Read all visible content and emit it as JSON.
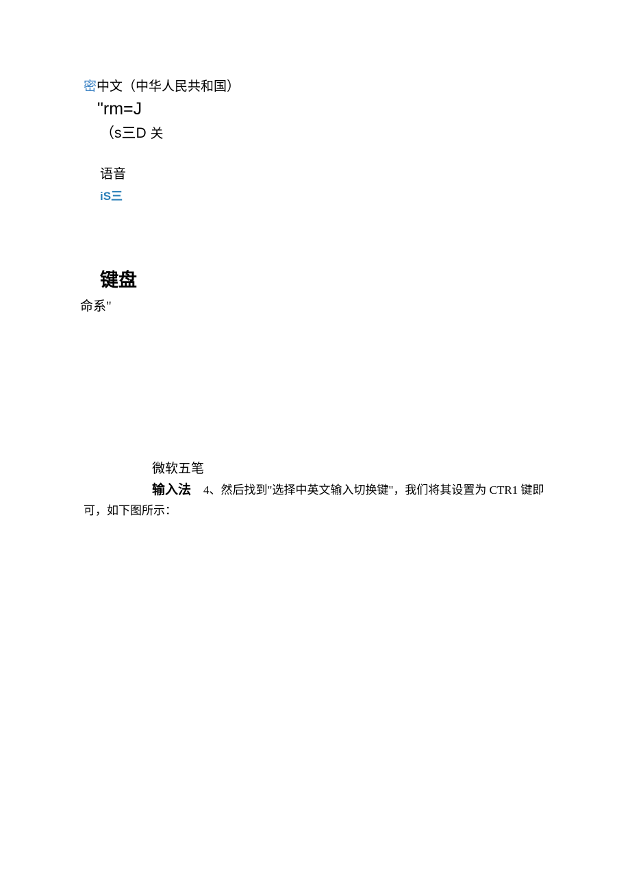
{
  "block1": {
    "mi": "密",
    "lang": "中文（中华人民共和国）",
    "rmj": "\"rm=J",
    "sed_open": "（s三D",
    "sed_close": "关",
    "yuyin": "语音",
    "ise": "iS三"
  },
  "block2": {
    "jianpan": "键盘",
    "mingxi": "命系\""
  },
  "block3": {
    "wubi": "微软五笔",
    "shurufa": "输入法",
    "step4_part1": "4、然后找到\"选择中英文输入切换键\"，我们将其设置为 CTR1 键即",
    "step4_part2": "可，如下图所示："
  }
}
